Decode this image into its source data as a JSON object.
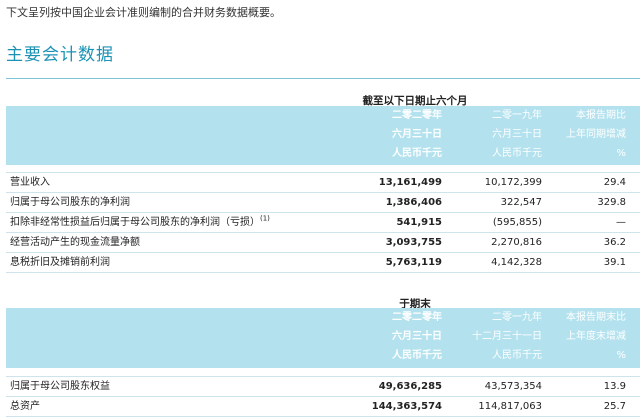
{
  "intro": "下文呈列按中国企业会计准则编制的合并财务数据概要。",
  "title": "主要会计数据",
  "section1": {
    "period_title": "截至以下日期止六个月",
    "columns": [
      {
        "l1": "二零二零年",
        "l2": "六月三十日",
        "l3": "人民币千元"
      },
      {
        "l1": "二零一九年",
        "l2": "六月三十日",
        "l3": "人民币千元"
      },
      {
        "l1": "本报告期比",
        "l2": "上年同期增减",
        "l3": "%"
      }
    ],
    "rows": [
      {
        "label": "营业收入",
        "note": "",
        "v2020": "13,161,499",
        "v2019": "10,172,399",
        "change": "29.4"
      },
      {
        "label": "归属于母公司股东的净利润",
        "note": "",
        "v2020": "1,386,406",
        "v2019": "322,547",
        "change": "329.8"
      },
      {
        "label": "扣除非经常性损益后归属于母公司股东的净利润（亏损）",
        "note": "(1)",
        "v2020": "541,915",
        "v2019": "(595,855)",
        "change": "—"
      },
      {
        "label": "经营活动产生的现金流量净额",
        "note": "",
        "v2020": "3,093,755",
        "v2019": "2,270,816",
        "change": "36.2"
      },
      {
        "label": "息税折旧及摊销前利润",
        "note": "",
        "v2020": "5,763,119",
        "v2019": "4,142,328",
        "change": "39.1"
      }
    ]
  },
  "section2": {
    "period_title": "于期末",
    "columns": [
      {
        "l1": "二零二零年",
        "l2": "六月三十日",
        "l3": "人民币千元"
      },
      {
        "l1": "二零一九年",
        "l2": "十二月三十一日",
        "l3": "人民币千元"
      },
      {
        "l1": "本报告期末比",
        "l2": "上年度末增减",
        "l3": "%"
      }
    ],
    "rows": [
      {
        "label": "归属于母公司股东权益",
        "v2020": "49,636,285",
        "v2019": "43,573,354",
        "change": "13.9"
      },
      {
        "label": "总资产",
        "v2020": "144,363,574",
        "v2019": "114,817,063",
        "change": "25.7"
      }
    ]
  }
}
